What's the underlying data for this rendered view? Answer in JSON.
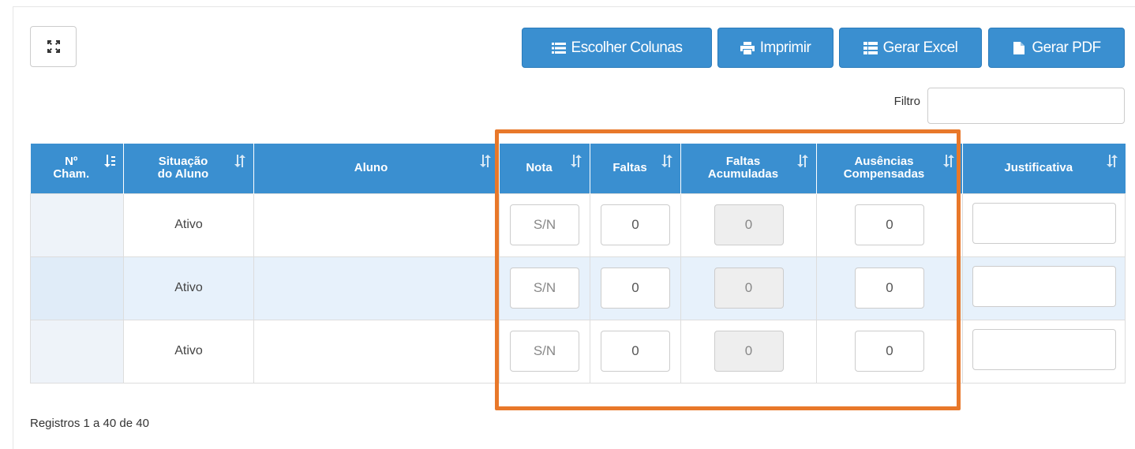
{
  "toolbar": {
    "choose_columns": "Escolher Colunas",
    "print": "Imprimir",
    "excel": "Gerar Excel",
    "pdf": "Gerar PDF"
  },
  "filter": {
    "label": "Filtro",
    "value": ""
  },
  "columns": {
    "num_line1": "Nº",
    "num_line2": "Cham.",
    "status_line1": "Situação",
    "status_line2": "do Aluno",
    "student": "Aluno",
    "grade": "Nota",
    "absences": "Faltas",
    "accum_line1": "Faltas",
    "accum_line2": "Acumuladas",
    "comp_line1": "Ausências",
    "comp_line2": "Compensadas",
    "justification": "Justificativa"
  },
  "rows": [
    {
      "num": "",
      "status": "Ativo",
      "student": "",
      "grade_placeholder": "S/N",
      "absences": "0",
      "accumulated": "0",
      "compensated": "0",
      "justification": ""
    },
    {
      "num": "",
      "status": "Ativo",
      "student": "",
      "grade_placeholder": "S/N",
      "absences": "0",
      "accumulated": "0",
      "compensated": "0",
      "justification": ""
    },
    {
      "num": "",
      "status": "Ativo",
      "student": "",
      "grade_placeholder": "S/N",
      "absences": "0",
      "accumulated": "0",
      "compensated": "0",
      "justification": ""
    }
  ],
  "footer": {
    "records": "Registros 1 a 40 de 40"
  },
  "colors": {
    "header_blue": "#3a8fd0",
    "highlight_orange": "#e8782a",
    "alt_row": "#e7f1fb"
  },
  "icons": {
    "expand": "expand-icon",
    "choose_columns": "list-icon",
    "print": "printer-icon",
    "excel": "table-icon",
    "pdf": "file-icon",
    "sort": "sort-icon"
  }
}
